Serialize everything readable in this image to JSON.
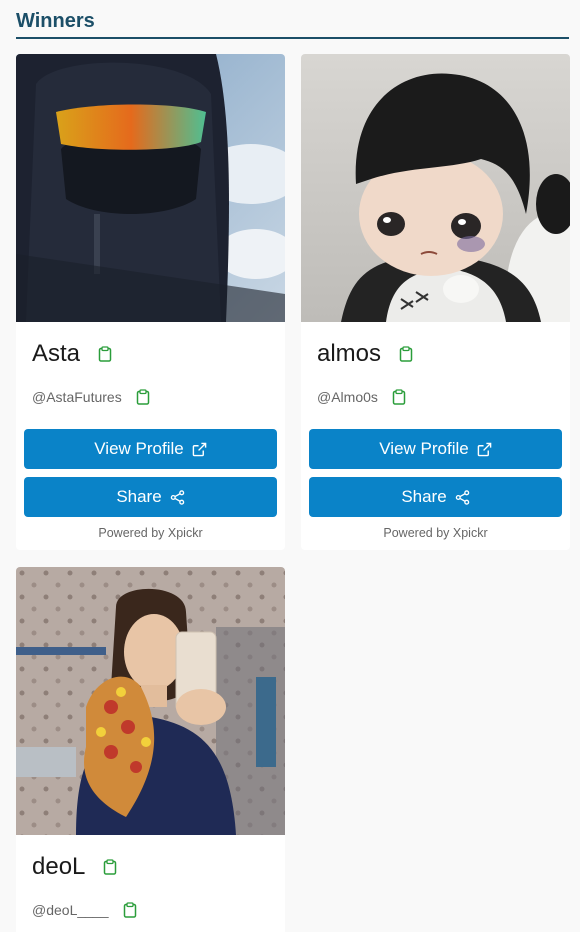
{
  "section_title": "Winners",
  "colors": {
    "accent": "#0a83c8",
    "title": "#1c4f68",
    "clipboard": "#2a9d3a"
  },
  "cards": [
    {
      "name": "Asta",
      "handle": "@AstaFutures",
      "view_label": "View Profile",
      "share_label": "Share",
      "powered": "Powered by Xpickr",
      "photo": "person-hood-goggles-photo"
    },
    {
      "name": "almos",
      "handle": "@Almo0s",
      "view_label": "View Profile",
      "share_label": "Share",
      "powered": "Powered by Xpickr",
      "photo": "toy-figurine-photo"
    },
    {
      "name": "deoL",
      "handle": "@deoL____",
      "photo": "woman-pizza-selfie-photo"
    }
  ],
  "icons": {
    "clipboard": "clipboard-icon",
    "external": "external-link-icon",
    "share": "share-icon"
  }
}
